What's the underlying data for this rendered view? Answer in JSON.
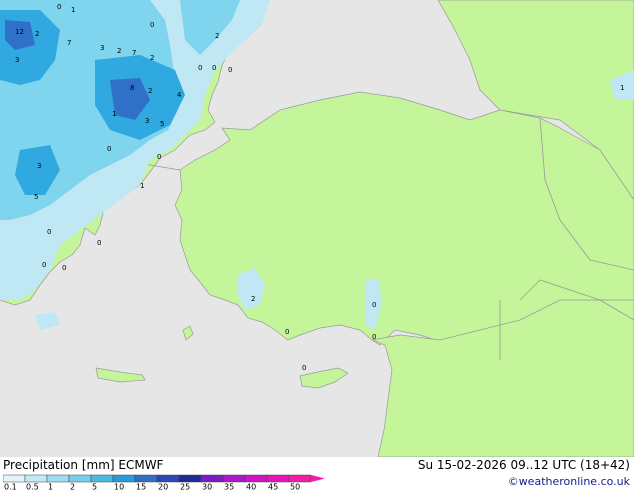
{
  "map": {
    "colors": {
      "sea": "#e6e6e6",
      "land": "#c4f59a",
      "border": "#999999",
      "precip_light": "#bfe8f4",
      "precip_mid": "#7fd4ee",
      "precip_heavy": "#30a8e0",
      "precip_dark": "#3070c8"
    },
    "value_labels": [
      "0",
      "1",
      "2",
      "3",
      "5",
      "12",
      "7",
      "4",
      "8"
    ]
  },
  "footer": {
    "title": "Precipitation [mm]  ECMWF",
    "timestamp": "Su 15-02-2026 09..12 UTC (18+42)",
    "copyright": "©weatheronline.co.uk"
  },
  "legend": {
    "labels": [
      "0.1",
      "0.5",
      "1",
      "2",
      "5",
      "10",
      "15",
      "20",
      "25",
      "30",
      "35",
      "40",
      "45",
      "50"
    ],
    "colors": [
      "#e0f4fa",
      "#c2eaf6",
      "#9fdcf1",
      "#78cdeb",
      "#4cb9e2",
      "#2b9ad8",
      "#2f6fc8",
      "#2c48b4",
      "#1e2898",
      "#7c1ac8",
      "#a818cc",
      "#d014c4",
      "#e614b4",
      "#f41ca4"
    ]
  }
}
